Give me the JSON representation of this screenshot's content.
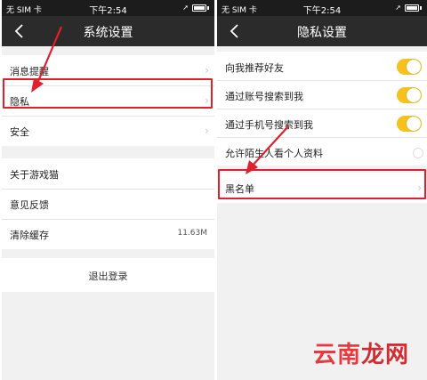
{
  "left_screen": {
    "status": {
      "carrier": "无 SIM 卡 ",
      "time": "下午2:54"
    },
    "title": "系统设置",
    "group1": [
      {
        "label": "消息提醒"
      },
      {
        "label": "隐私"
      },
      {
        "label": "安全"
      }
    ],
    "group2": [
      {
        "label": "关于游戏猫"
      },
      {
        "label": "意见反馈"
      },
      {
        "label": "清除缓存",
        "value": "11.63M"
      }
    ],
    "logout": "退出登录"
  },
  "right_screen": {
    "status": {
      "carrier": "无 SIM 卡 ",
      "time": "下午2:54"
    },
    "title": "隐私设置",
    "toggles": [
      {
        "label": "向我推荐好友",
        "state": "on"
      },
      {
        "label": "通过账号搜索到我",
        "state": "on"
      },
      {
        "label": "通过手机号搜索到我",
        "state": "on"
      },
      {
        "label": "允许陌生人看个人资料",
        "state": "partial"
      }
    ],
    "blacklist": "黑名单"
  },
  "icons": {
    "back": "chevron-left-icon",
    "chevron": "chevron-right-icon",
    "arrow": "red-arrow-icon"
  },
  "colors": {
    "toggle_on": "#f5c21b",
    "highlight": "#e0202c",
    "navbar": "#2b2b2b"
  },
  "watermark": {
    "part1": "云南",
    "part2": "龙网"
  }
}
